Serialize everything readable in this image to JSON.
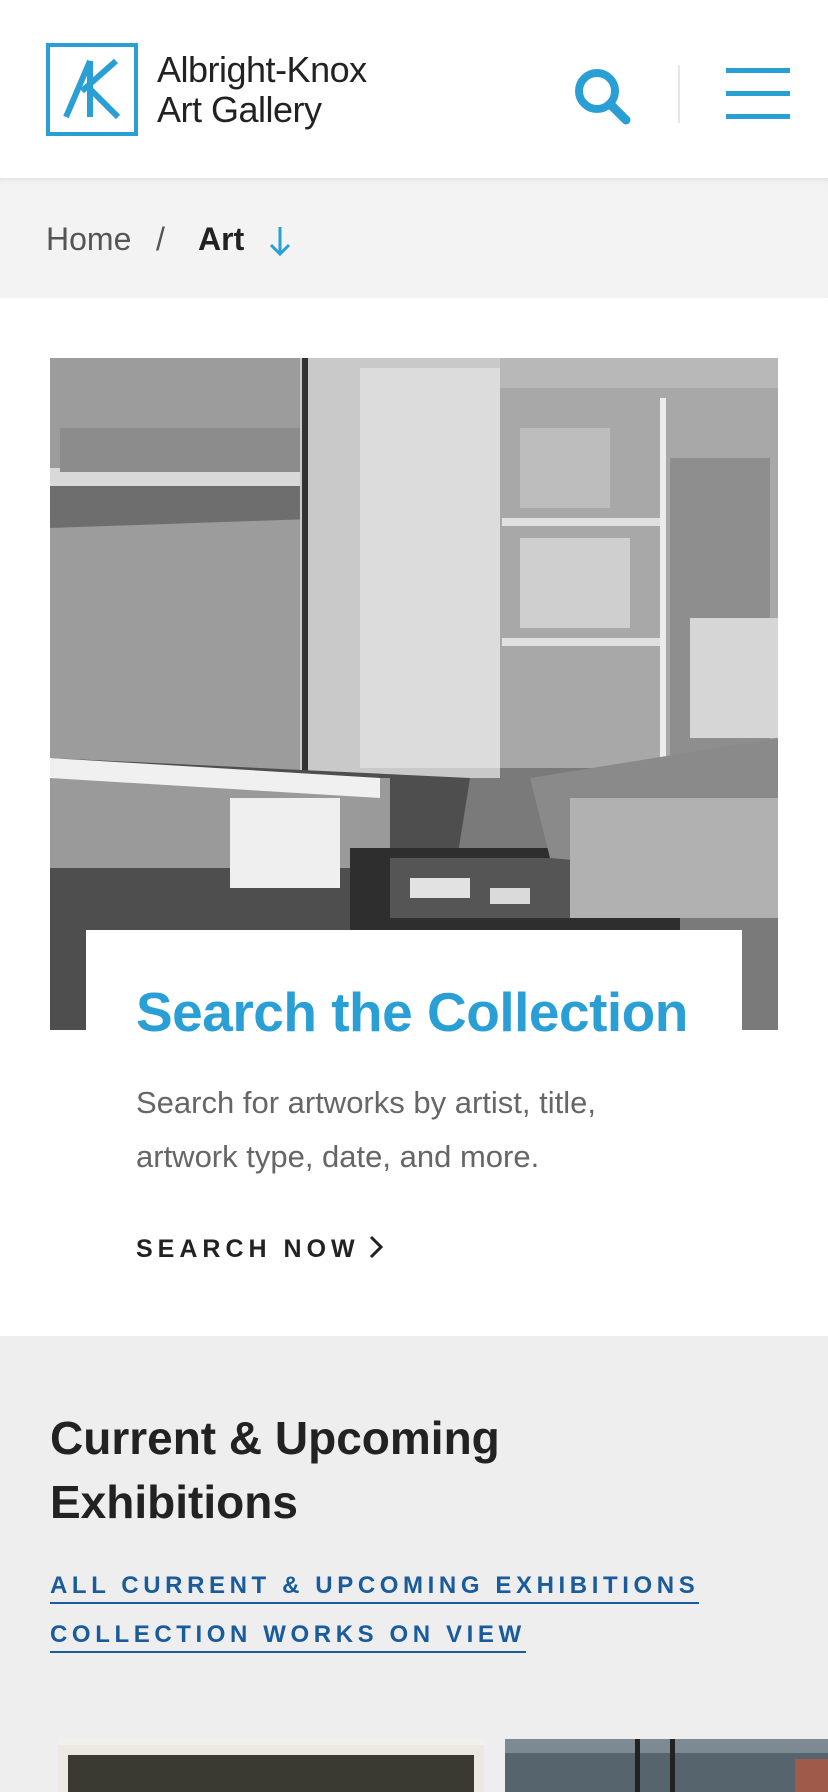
{
  "header": {
    "logo_line1": "Albright-Knox",
    "logo_line2": "Art Gallery",
    "accent_color": "#2a9fd6",
    "icons": [
      "search-icon",
      "menu-icon"
    ]
  },
  "breadcrumb": {
    "home": "Home",
    "separator": "/",
    "current": "Art"
  },
  "collection_card": {
    "title": "Search the Collection",
    "description": "Search for artworks by artist, title, artwork type, date, and more.",
    "cta": "SEARCH NOW",
    "title_color": "#2a9fd6"
  },
  "exhibitions": {
    "heading": "Current & Upcoming Exhibitions",
    "links": [
      "ALL CURRENT & UPCOMING EXHIBITIONS",
      "COLLECTION WORKS ON VIEW"
    ],
    "link_color": "#1a5b9c"
  }
}
